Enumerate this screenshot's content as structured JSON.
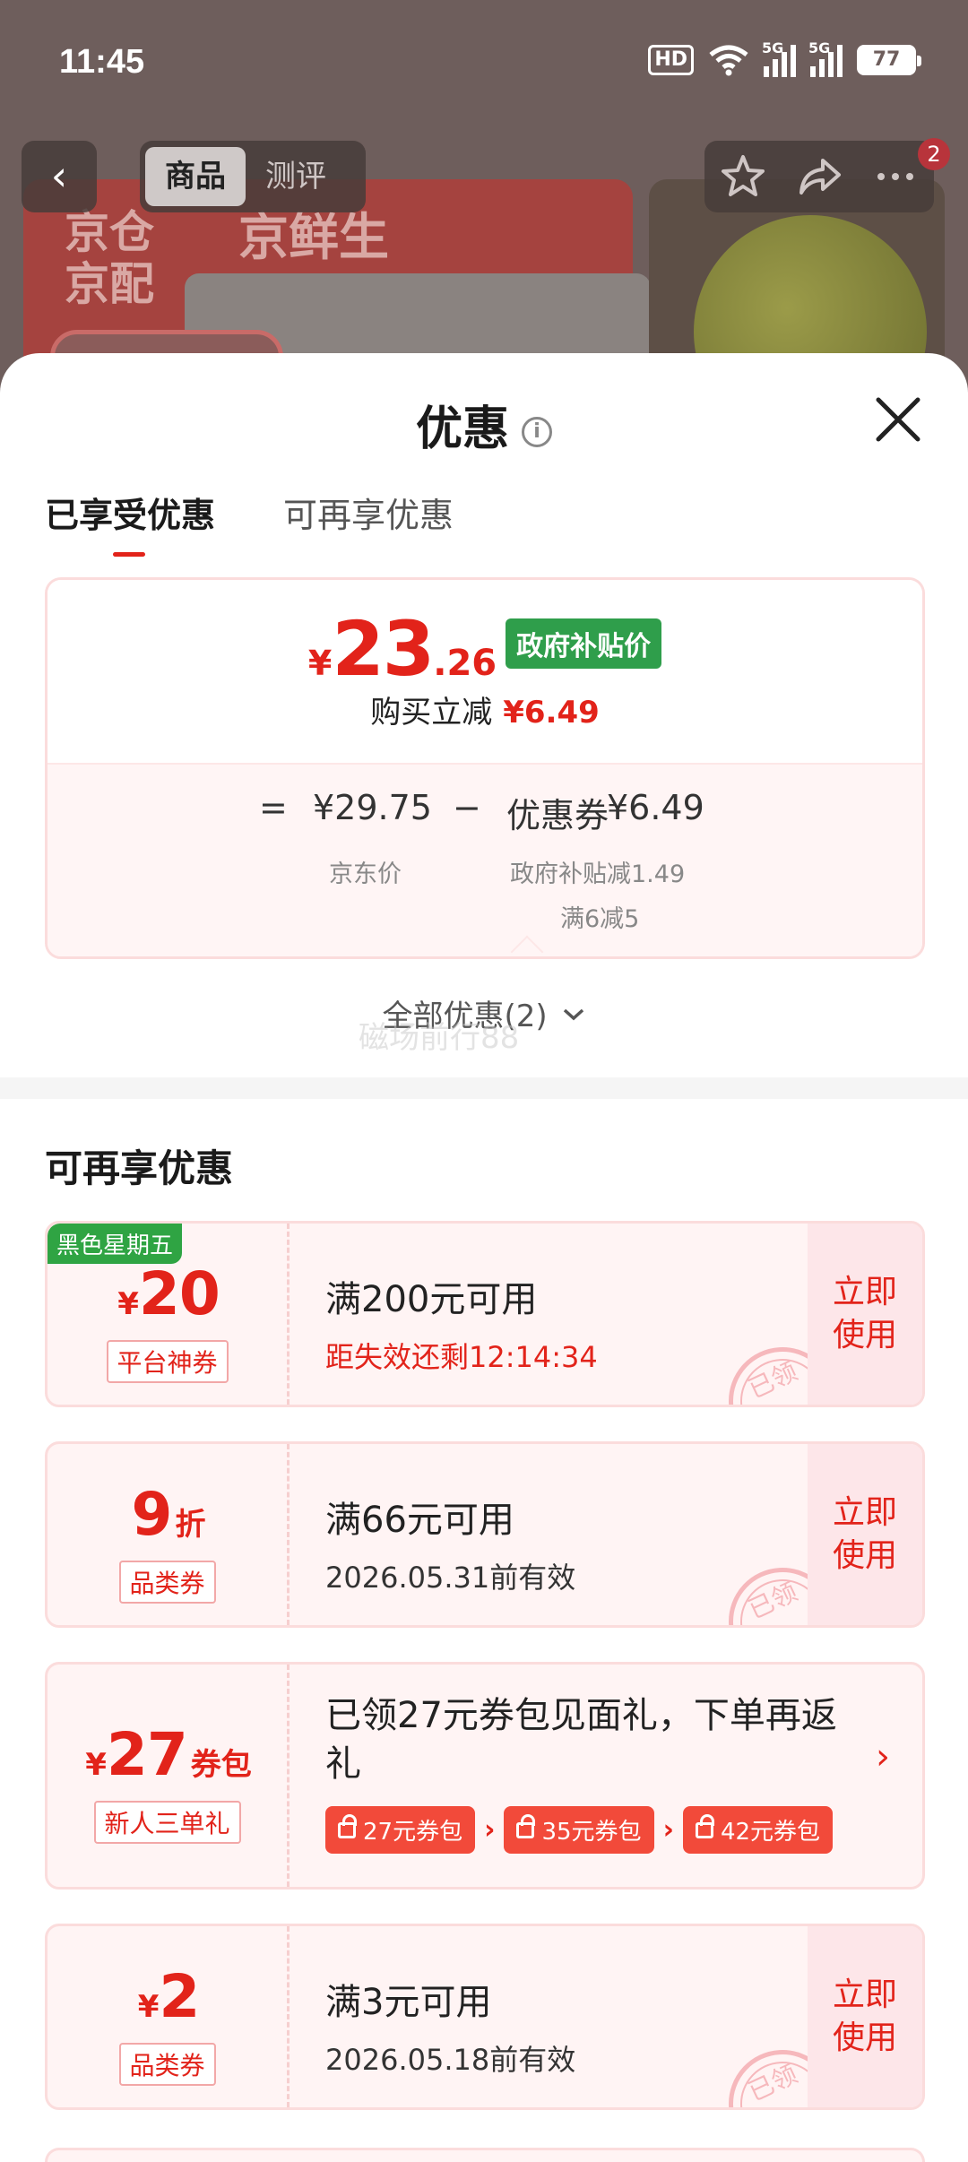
{
  "status_bar": {
    "time": "11:45",
    "hd": "HD",
    "net1": "5G",
    "net2": "5G",
    "battery": "77"
  },
  "nav": {
    "back": "‹",
    "tab_goods": "商品",
    "tab_review": "测评",
    "cart_badge": "2"
  },
  "background": {
    "banner_line1": "京仓",
    "banner_line2": "京配",
    "banner_brand": "京鲜生"
  },
  "sheet": {
    "title": "优惠",
    "info_glyph": "i",
    "tabs": [
      "已享受优惠",
      "可再享优惠"
    ],
    "summary": {
      "yen": "¥",
      "price_int": "23",
      "price_dec": ".26",
      "gov_label": "政府补贴价",
      "instant_label": "购买立减",
      "instant_amount": "¥6.49",
      "eq": "=",
      "jd_price": "¥29.75",
      "minus": "−",
      "coupon_label": "优惠券",
      "coupon_amount": "¥6.49",
      "jd_price_label": "京东价",
      "gov_subsidy": "政府补贴减1.49",
      "full_reduce": "满6减5"
    },
    "all_promos": "全部优惠(2)",
    "watermark": "磁场前行88",
    "section_title": "可再享优惠",
    "coupons": [
      {
        "tag": "黑色星期五",
        "yen": "¥",
        "amount": "20",
        "unit": "",
        "type": "平台神券",
        "condition": "满200元可用",
        "expire": "距失效还剩12:14:34",
        "action": "立即使用",
        "stamp": "已领"
      },
      {
        "yen": "",
        "amount": "9",
        "unit": "折",
        "type": "品类券",
        "condition": "满66元可用",
        "expire": "2026.05.31前有效",
        "action": "立即使用",
        "stamp": "已领"
      },
      {
        "yen": "¥",
        "amount": "27",
        "unit": "券包",
        "type": "新人三单礼",
        "condition": "已领27元券包见面礼，下单再返礼",
        "chips": [
          "27元券包",
          "35元券包",
          "42元券包"
        ],
        "arrow": "›"
      },
      {
        "yen": "¥",
        "amount": "2",
        "unit": "",
        "type": "品类券",
        "condition": "满3元可用",
        "expire": "2026.05.18前有效",
        "action": "立即使用",
        "stamp": "已领"
      }
    ]
  }
}
